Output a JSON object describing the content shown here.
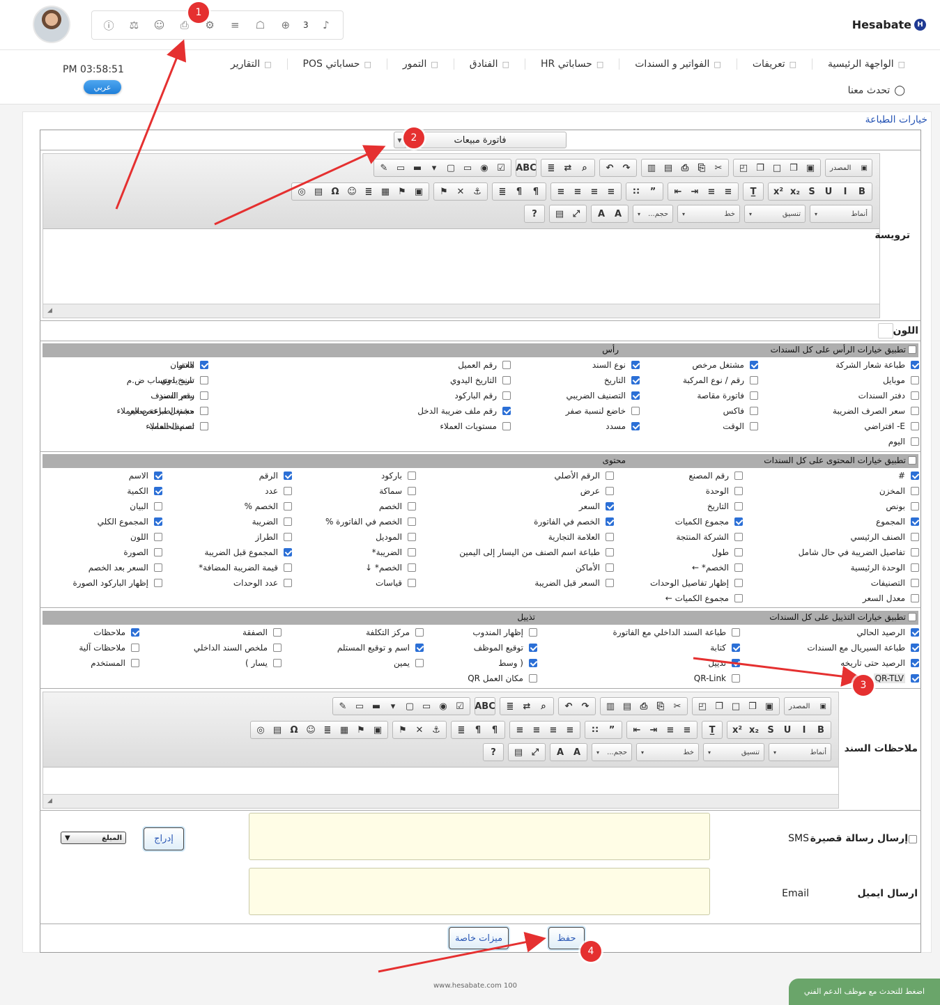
{
  "brand": {
    "name": "Hesabate",
    "mark": "H"
  },
  "header": {
    "icon_bar": [
      {
        "name": "info-icon",
        "glyph": "ⓘ"
      },
      {
        "name": "money-bag-icon",
        "glyph": "⚖"
      },
      {
        "name": "users-icon",
        "glyph": "☺"
      },
      {
        "name": "printer-icon",
        "glyph": "⎙"
      },
      {
        "name": "gear-icon",
        "glyph": "⚙"
      },
      {
        "name": "database-icon",
        "glyph": "≡"
      },
      {
        "name": "android-icon",
        "glyph": "☖"
      },
      {
        "name": "plus-circle-icon",
        "glyph": "⊕"
      }
    ],
    "notification_count": "3",
    "clock": "PM 03:58:51",
    "language_badge": "عربي",
    "nav": [
      {
        "label": "الواجهة الرئيسية",
        "name": "nav-home"
      },
      {
        "label": "تعريفات",
        "name": "nav-definitions"
      },
      {
        "label": "الفواتير و السندات",
        "name": "nav-invoices"
      },
      {
        "label": "حساباتي HR",
        "name": "nav-hr"
      },
      {
        "label": "الفنادق",
        "name": "nav-hotels"
      },
      {
        "label": "التمور",
        "name": "nav-dates"
      },
      {
        "label": "حساباتي POS",
        "name": "nav-pos"
      },
      {
        "label": "التقارير",
        "name": "nav-reports"
      }
    ],
    "chat": "تحدث معنا"
  },
  "breadcrumb": "خيارات الطباعة",
  "document_type": "فاتورة مبيعات",
  "header_editor_label": "ترويسة",
  "notes_editor_label": "ملاحظات السند",
  "toolbar": {
    "source": "المصدر",
    "styles": "أنماط",
    "format": "تنسيق",
    "font": "خط",
    "size": "حجم..."
  },
  "color_label": "اللون",
  "header_section": {
    "apply_all": "تطبيق خيارات الرأس على كل السندات",
    "title": "رأس",
    "options": [
      {
        "label": "طباعة شعار الشركة",
        "checked": true
      },
      {
        "label": "مشتغل مرخص",
        "checked": true
      },
      {
        "label": "نوع السند",
        "checked": true
      },
      {
        "label": "رقم العميل",
        "checked": false
      },
      {
        "label": "العنوان",
        "checked": true
      },
      {
        "label": "هاتف",
        "checked": true
      },
      {
        "label": "موبايل",
        "checked": false
      },
      {
        "label": "رقم / نوع المركبة",
        "checked": false
      },
      {
        "label": "التاريخ",
        "checked": true
      },
      {
        "label": "التاريخ اليدوي",
        "checked": false
      },
      {
        "label": "تاريخ احتساب ض.م",
        "checked": false
      },
      {
        "label": "سند يدوي",
        "checked": false
      },
      {
        "label": "دفتر السندات",
        "checked": false
      },
      {
        "label": "فاتورة مقاصة",
        "checked": false
      },
      {
        "label": "التصنيف الضريبي",
        "checked": true
      },
      {
        "label": "رقم الباركود",
        "checked": false
      },
      {
        "label": "رقم السند",
        "checked": true
      },
      {
        "label": "سعر الصرف",
        "checked": false
      },
      {
        "label": "سعر الصرف الضريبة",
        "checked": false
      },
      {
        "label": "فاكس",
        "checked": false
      },
      {
        "label": "خاضع لنسبة صفر",
        "checked": false
      },
      {
        "label": "رقم ملف ضريبة الدخل",
        "checked": true
      },
      {
        "label": "حجم الطباعة صغير",
        "checked": false
      },
      {
        "label": "مشتغل مرخص-العملاء",
        "checked": false
      },
      {
        "label": "E- افتراضي",
        "checked": false
      },
      {
        "label": "الوقت",
        "checked": false
      },
      {
        "label": "مسدد",
        "checked": true
      },
      {
        "label": "مستويات العملاء",
        "checked": false
      },
      {
        "label": "تصنيف العملاء",
        "checked": false
      },
      {
        "label": "اسم الحساب",
        "checked": false
      },
      {
        "label": "اليوم",
        "checked": false
      }
    ]
  },
  "content_section": {
    "apply_all": "تطبيق خيارات المحتوى على كل السندات",
    "title": "محتوى",
    "options": [
      {
        "label": "#",
        "checked": true
      },
      {
        "label": "رقم المصنع",
        "checked": false
      },
      {
        "label": "الرقم الأصلي",
        "checked": false
      },
      {
        "label": "باركود",
        "checked": false
      },
      {
        "label": "الرقم",
        "checked": true
      },
      {
        "label": "الاسم",
        "checked": true
      },
      {
        "label": "المخزن",
        "checked": false
      },
      {
        "label": "الوحدة",
        "checked": false
      },
      {
        "label": "عرض",
        "checked": false
      },
      {
        "label": "سماكة",
        "checked": false
      },
      {
        "label": "عدد",
        "checked": false
      },
      {
        "label": "الكمية",
        "checked": true
      },
      {
        "label": "بونص",
        "checked": false
      },
      {
        "label": "التاريخ",
        "checked": false
      },
      {
        "label": "السعر",
        "checked": true
      },
      {
        "label": "الخصم",
        "checked": false
      },
      {
        "label": "الخصم %",
        "checked": false
      },
      {
        "label": "البيان",
        "checked": false
      },
      {
        "label": "المجموع",
        "checked": true
      },
      {
        "label": "مجموع الكميات",
        "checked": true
      },
      {
        "label": "الخصم في الفاتورة",
        "checked": true
      },
      {
        "label": "الخصم في الفاتورة %",
        "checked": false
      },
      {
        "label": "الضريبة",
        "checked": false
      },
      {
        "label": "المجموع الكلي",
        "checked": true
      },
      {
        "label": "الصنف الرئيسي",
        "checked": false
      },
      {
        "label": "الشركة المنتجة",
        "checked": false
      },
      {
        "label": "العلامة التجارية",
        "checked": false
      },
      {
        "label": "الموديل",
        "checked": false
      },
      {
        "label": "الطراز",
        "checked": false
      },
      {
        "label": "اللون",
        "checked": false
      },
      {
        "label": "تفاصيل الضريبة في حال شامل",
        "checked": false
      },
      {
        "label": "طول",
        "checked": false
      },
      {
        "label": "طباعة اسم الصنف من اليسار إلى اليمين",
        "checked": false
      },
      {
        "label": "الضريبة*",
        "checked": false
      },
      {
        "label": "المجموع قبل الضريبة",
        "checked": true
      },
      {
        "label": "الصورة",
        "checked": false
      },
      {
        "label": "الوحدة الرئيسية",
        "checked": false
      },
      {
        "label": "الخصم* ←",
        "checked": false
      },
      {
        "label": "الأماكن",
        "checked": false
      },
      {
        "label": "الخصم* ↓",
        "checked": false
      },
      {
        "label": "قيمة الضريبة المضافة*",
        "checked": false
      },
      {
        "label": "السعر بعد الخصم",
        "checked": false
      },
      {
        "label": "التصنيفات",
        "checked": false
      },
      {
        "label": "إظهار تفاصيل الوحدات",
        "checked": false
      },
      {
        "label": "السعر قبل الضريبة",
        "checked": false
      },
      {
        "label": "قياسات",
        "checked": false
      },
      {
        "label": "عدد الوحدات",
        "checked": false
      },
      {
        "label": "إظهار الباركود الصورة",
        "checked": false
      },
      {
        "label": "معدل السعر",
        "checked": false
      },
      {
        "label": "مجموع الكميات ←",
        "checked": false
      }
    ]
  },
  "footer_section": {
    "apply_all": "تطبيق خيارات التذييل على كل السندات",
    "title": "تذييل",
    "options": [
      {
        "label": "الرصيد الحالي",
        "checked": true
      },
      {
        "label": "طباعة السند الداخلي مع الفاتورة",
        "checked": false
      },
      {
        "label": "إظهار المندوب",
        "checked": false
      },
      {
        "label": "مركز التكلفة",
        "checked": false
      },
      {
        "label": "الصفقة",
        "checked": false
      },
      {
        "label": "ملاحظات",
        "checked": true
      },
      {
        "label": "طباعة السيريال مع السندات",
        "checked": true
      },
      {
        "label": "كتابة",
        "checked": true
      },
      {
        "label": "توقيع الموظف",
        "checked": true
      },
      {
        "label": "اسم و توقيع المستلم",
        "checked": true
      },
      {
        "label": "ملخص السند الداخلي",
        "checked": false
      },
      {
        "label": "ملاحظات آلية",
        "checked": false
      },
      {
        "label": "الرصيد حتى تاريخه",
        "checked": true
      },
      {
        "label": "تذييل",
        "checked": true
      },
      {
        "label": "( وسط",
        "checked": true
      },
      {
        "label": "يمين",
        "checked": false
      },
      {
        "label": "يسار )",
        "checked": false
      },
      {
        "label": "المستخدم",
        "checked": false
      },
      {
        "label": "QR-TLV",
        "checked": true
      },
      {
        "label": "QR-Link",
        "checked": false
      },
      {
        "label": "مكان العمل QR",
        "checked": false
      }
    ]
  },
  "sms": {
    "label": "إرسال رسالة قصيرة",
    "tag": "SMS",
    "insert_button": "إدراج",
    "field_select": "المبلغ"
  },
  "email": {
    "label": "ارسال ايميل",
    "tag": "Email"
  },
  "actions": {
    "save": "حفظ",
    "special": "ميزات خاصة"
  },
  "footer": {
    "site": "www.hesabate.com 100",
    "support": "اضغط للتحدث مع موظف الدعم الفني"
  },
  "markers": [
    "1",
    "2",
    "3",
    "4"
  ],
  "colors": {
    "accent": "#2b6fd6",
    "marker": "#e53030",
    "support": "#6aa56a"
  }
}
